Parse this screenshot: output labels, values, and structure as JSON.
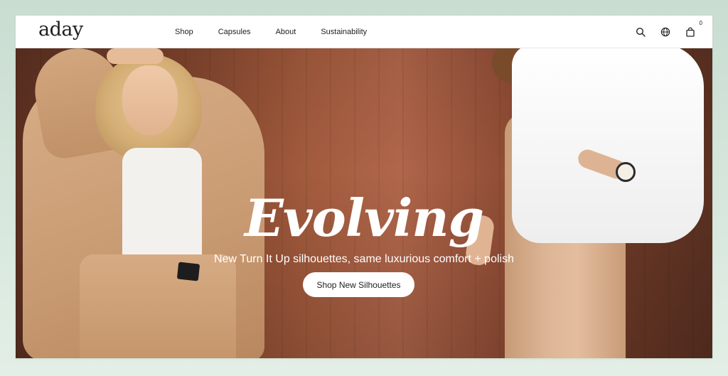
{
  "brand": {
    "logo_text": "aday"
  },
  "nav": {
    "links": [
      "Shop",
      "Capsules",
      "About",
      "Sustainability"
    ]
  },
  "header_icons": {
    "search": "search-icon",
    "language": "globe-icon",
    "cart": "shopping-bag-icon",
    "cart_count": "0"
  },
  "hero": {
    "headline": "Evolving",
    "subheadline": "New Turn It Up silhouettes, same luxurious comfort + polish",
    "cta_label": "Shop New Silhouettes"
  },
  "colors": {
    "background": "#d7e7dc",
    "header_bg": "#ffffff",
    "text": "#222222",
    "hero_text": "#ffffff",
    "cta_bg": "#ffffff"
  }
}
